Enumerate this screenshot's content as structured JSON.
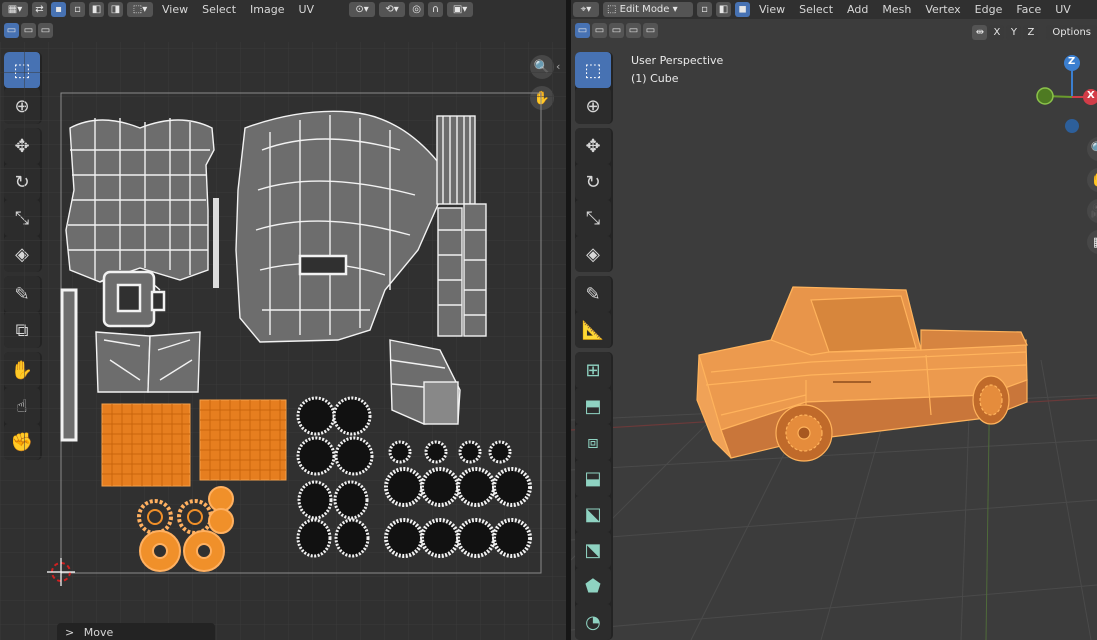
{
  "uv_editor": {
    "header": {
      "menus": [
        "View",
        "Select",
        "Image",
        "UV"
      ]
    },
    "move_panel": {
      "label": "Move",
      "chevron": ">"
    }
  },
  "viewport_3d": {
    "header": {
      "mode_label": "Edit Mode",
      "menus": [
        "View",
        "Select",
        "Add",
        "Mesh",
        "Vertex",
        "Edge",
        "Face",
        "UV"
      ]
    },
    "axis_toggles": [
      "X",
      "Y",
      "Z"
    ],
    "options_label": "Options",
    "overlay_line1": "User Perspective",
    "overlay_line2": "(1) Cube",
    "gizmo": {
      "z_label": "Z",
      "x_label": "X"
    },
    "selection_color": "#f0902a",
    "active_tool_color": "#4772b3"
  }
}
